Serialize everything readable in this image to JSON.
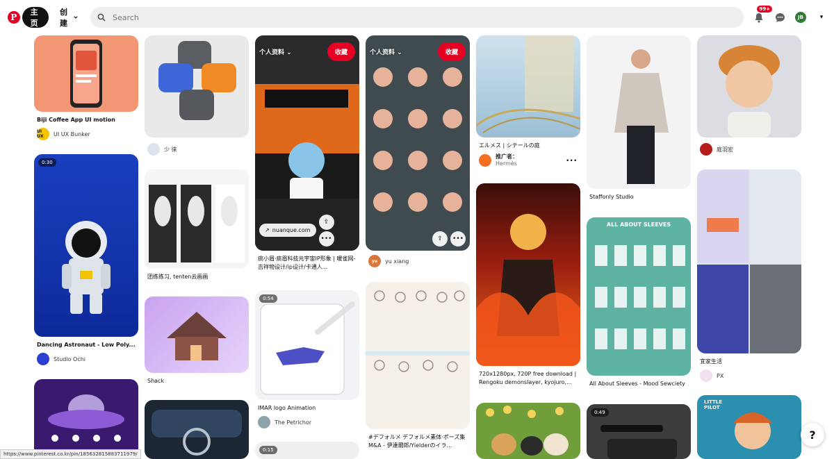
{
  "header": {
    "logo_letter": "P",
    "home_label": "主页",
    "create_label": "创建",
    "search_placeholder": "Search",
    "notification_count": "99+",
    "avatar_initials": "JB"
  },
  "pins": {
    "p1": {
      "title": "Biji Coffee App UI motion",
      "author": "UI UX Bunker",
      "author_badge": "UI UX"
    },
    "p2": {
      "duration": "0:30",
      "title": "Dancing Astronaut - Low Poly...",
      "author": "Studio Ochi"
    },
    "p4": {
      "author": "少 徕"
    },
    "p5": {
      "title": "团练练习, tenten云画画"
    },
    "p6": {
      "title": "Shack"
    },
    "p8": {
      "profile_label": "个人资料",
      "save_label": "收藏",
      "link_label": "nuanque.com",
      "title": "痰小眉·痰眉科技元宇宙IP形象 | 暖雀网-吉祥物设计/ip设计/卡通人..."
    },
    "p9": {
      "duration": "0:54",
      "title": "IMAR logo Animation",
      "author": "The Petrichor"
    },
    "p10": {
      "duration": "0:15"
    },
    "p11": {
      "profile_label": "个人资料",
      "save_label": "收藏",
      "author": "yu xiang",
      "author_initials": "yu"
    },
    "p12": {
      "title": "#デフォルメ デフォルメ素体·ポーズ集M&A - 伊達爾郎/Yielderのイラ..."
    },
    "p13": {
      "title": "エルメス | シテールの庭",
      "promoted": "推广者：",
      "author": "Hermès"
    },
    "p14": {
      "title": "720x1280px, 720P free download | Rengoku demonslayer, kyojuro,..."
    },
    "p16": {
      "title": "Staffonly Studio"
    },
    "p17": {
      "title": "All About Sleeves - Mood Sewciety",
      "poster_title": "ALL ABOUT SLEEVES"
    },
    "p18": {
      "duration": "0:49"
    },
    "p19": {
      "author": "庭羽宏"
    },
    "p20": {
      "title": "宜家生活",
      "author": "PX"
    },
    "p21": {
      "poster_text": "LITTLE PILOT"
    }
  },
  "status_url": "https://www.pinterest.co.kr/pin/185632815883711979/",
  "help_label": "?",
  "colors": {
    "brand": "#e60023",
    "search_bg": "#efefef"
  }
}
